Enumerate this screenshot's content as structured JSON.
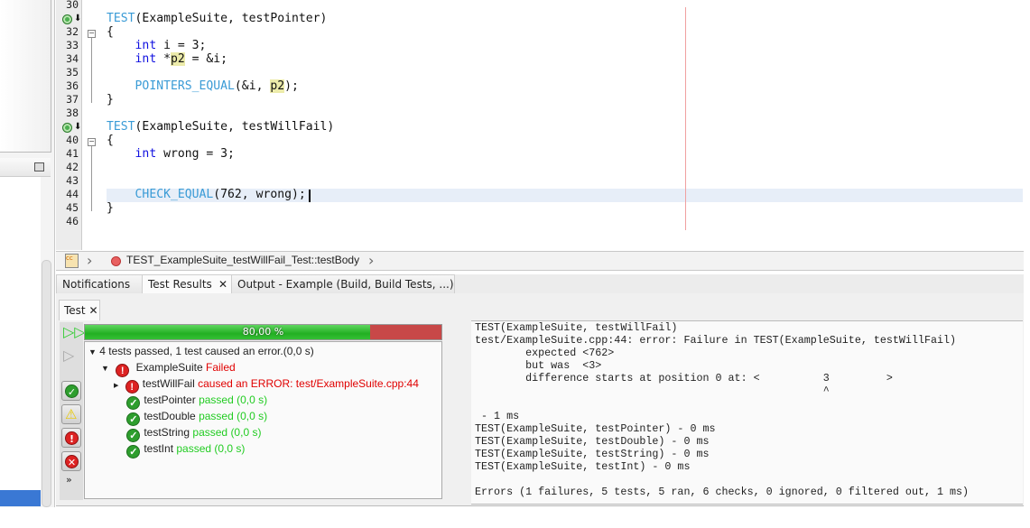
{
  "editor": {
    "line_numbers": [
      "30",
      "31",
      "32",
      "33",
      "34",
      "35",
      "36",
      "37",
      "38",
      "39",
      "40",
      "41",
      "42",
      "43",
      "44",
      "45",
      "46"
    ],
    "code_lines": [
      [],
      [
        [
          "TEST",
          "mac"
        ],
        [
          "(ExampleSuite, testPointer)",
          ""
        ]
      ],
      [
        [
          "{",
          ""
        ]
      ],
      [
        [
          "    ",
          ""
        ],
        [
          "int",
          "kw"
        ],
        [
          " i = 3;",
          ""
        ]
      ],
      [
        [
          "    ",
          ""
        ],
        [
          "int",
          "kw"
        ],
        [
          " *",
          ""
        ],
        [
          "p2",
          "hl"
        ],
        [
          " = &i;",
          ""
        ]
      ],
      [],
      [
        [
          "    ",
          ""
        ],
        [
          "POINTERS_EQUAL",
          "mac"
        ],
        [
          "(&i, ",
          ""
        ],
        [
          "p2",
          "hl"
        ],
        [
          ");",
          ""
        ]
      ],
      [
        [
          "}",
          ""
        ]
      ],
      [],
      [
        [
          "TEST",
          "mac"
        ],
        [
          "(ExampleSuite, testWillFail)",
          ""
        ]
      ],
      [
        [
          "{",
          ""
        ]
      ],
      [
        [
          "    ",
          ""
        ],
        [
          "int",
          "kw"
        ],
        [
          " wrong = 3;",
          ""
        ]
      ],
      [],
      [],
      [
        [
          "    ",
          ""
        ],
        [
          "CHECK_EQUAL",
          "mac"
        ],
        [
          "(762, wrong);",
          ""
        ]
      ],
      [
        [
          "}",
          ""
        ]
      ],
      []
    ],
    "current_line": "44"
  },
  "breadcrumb": {
    "function": "TEST_ExampleSuite_testWillFail_Test::testBody"
  },
  "tabs": [
    {
      "label": "Notifications"
    },
    {
      "label": "Test Results",
      "close": "✕"
    },
    {
      "label": "Output - Example (Build, Build Tests, ...)"
    }
  ],
  "subtab": {
    "label": "Test",
    "close": "✕"
  },
  "progress": {
    "percent": 80,
    "label": "80,00 %",
    "pass_color": "#2db82d",
    "fail_color": "#c84848"
  },
  "tree": {
    "summary": "4 tests passed, 1 test caused an error.(0,0 s)",
    "suite": {
      "name": "ExampleSuite",
      "status": "Failed"
    },
    "tests": [
      {
        "name": "testWillFail",
        "status": "caused an ERROR: test/ExampleSuite.cpp:44",
        "time": "",
        "result": "error"
      },
      {
        "name": "testPointer",
        "status": "passed",
        "time": "(0,0 s)",
        "result": "ok"
      },
      {
        "name": "testDouble",
        "status": "passed",
        "time": "(0,0 s)",
        "result": "ok"
      },
      {
        "name": "testString",
        "status": "passed",
        "time": "(0,0 s)",
        "result": "ok"
      },
      {
        "name": "testInt",
        "status": "passed",
        "time": "(0,0 s)",
        "result": "ok"
      }
    ]
  },
  "toolbar": {
    "more": "»"
  },
  "output": {
    "lines": [
      "TEST(ExampleSuite, testWillFail)",
      "test/ExampleSuite.cpp:44: error: Failure in TEST(ExampleSuite, testWillFail)",
      "        expected <762>",
      "        but was  <3>",
      "        difference starts at position 0 at: <          3         >",
      "                                                       ^",
      "",
      " - 1 ms",
      "TEST(ExampleSuite, testPointer) - 0 ms",
      "TEST(ExampleSuite, testDouble) - 0 ms",
      "TEST(ExampleSuite, testString) - 0 ms",
      "TEST(ExampleSuite, testInt) - 0 ms",
      ""
    ],
    "summary": "Errors (1 failures, 5 tests, 5 ran, 6 checks, 0 ignored, 0 filtered out, 1 ms)"
  }
}
